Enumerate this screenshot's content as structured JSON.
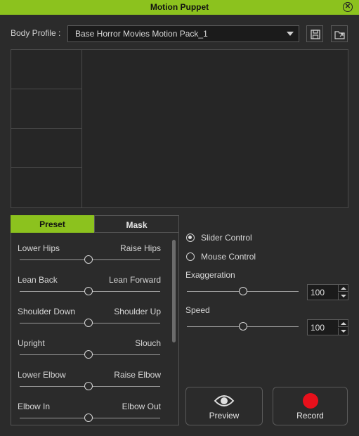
{
  "window": {
    "title": "Motion Puppet",
    "close_icon": "close-icon"
  },
  "profile": {
    "label": "Body Profile :",
    "selected": "Base Horror Movies Motion Pack_1",
    "save_icon": "save-icon",
    "import_icon": "folder-import-icon"
  },
  "tabs": {
    "preset": "Preset",
    "mask": "Mask",
    "active": "Preset"
  },
  "preset_rows": [
    {
      "left": "Lower Hips",
      "right": "Raise Hips",
      "value": 0.5
    },
    {
      "left": "Lean Back",
      "right": "Lean Forward",
      "value": 0.5
    },
    {
      "left": "Shoulder Down",
      "right": "Shoulder Up",
      "value": 0.5
    },
    {
      "left": "Upright",
      "right": "Slouch",
      "value": 0.5
    },
    {
      "left": "Lower Elbow",
      "right": "Raise Elbow",
      "value": 0.5
    },
    {
      "left": "Elbow In",
      "right": "Elbow Out",
      "value": 0.5
    }
  ],
  "control_mode": {
    "slider_control": "Slider Control",
    "mouse_control": "Mouse Control",
    "selected": "Slider Control"
  },
  "exaggeration": {
    "label": "Exaggeration",
    "value": "100"
  },
  "speed": {
    "label": "Speed",
    "value": "100"
  },
  "buttons": {
    "preview": "Preview",
    "record": "Record"
  },
  "colors": {
    "accent": "#8cc21e",
    "record": "#e8101b",
    "background": "#2b2b2b"
  }
}
